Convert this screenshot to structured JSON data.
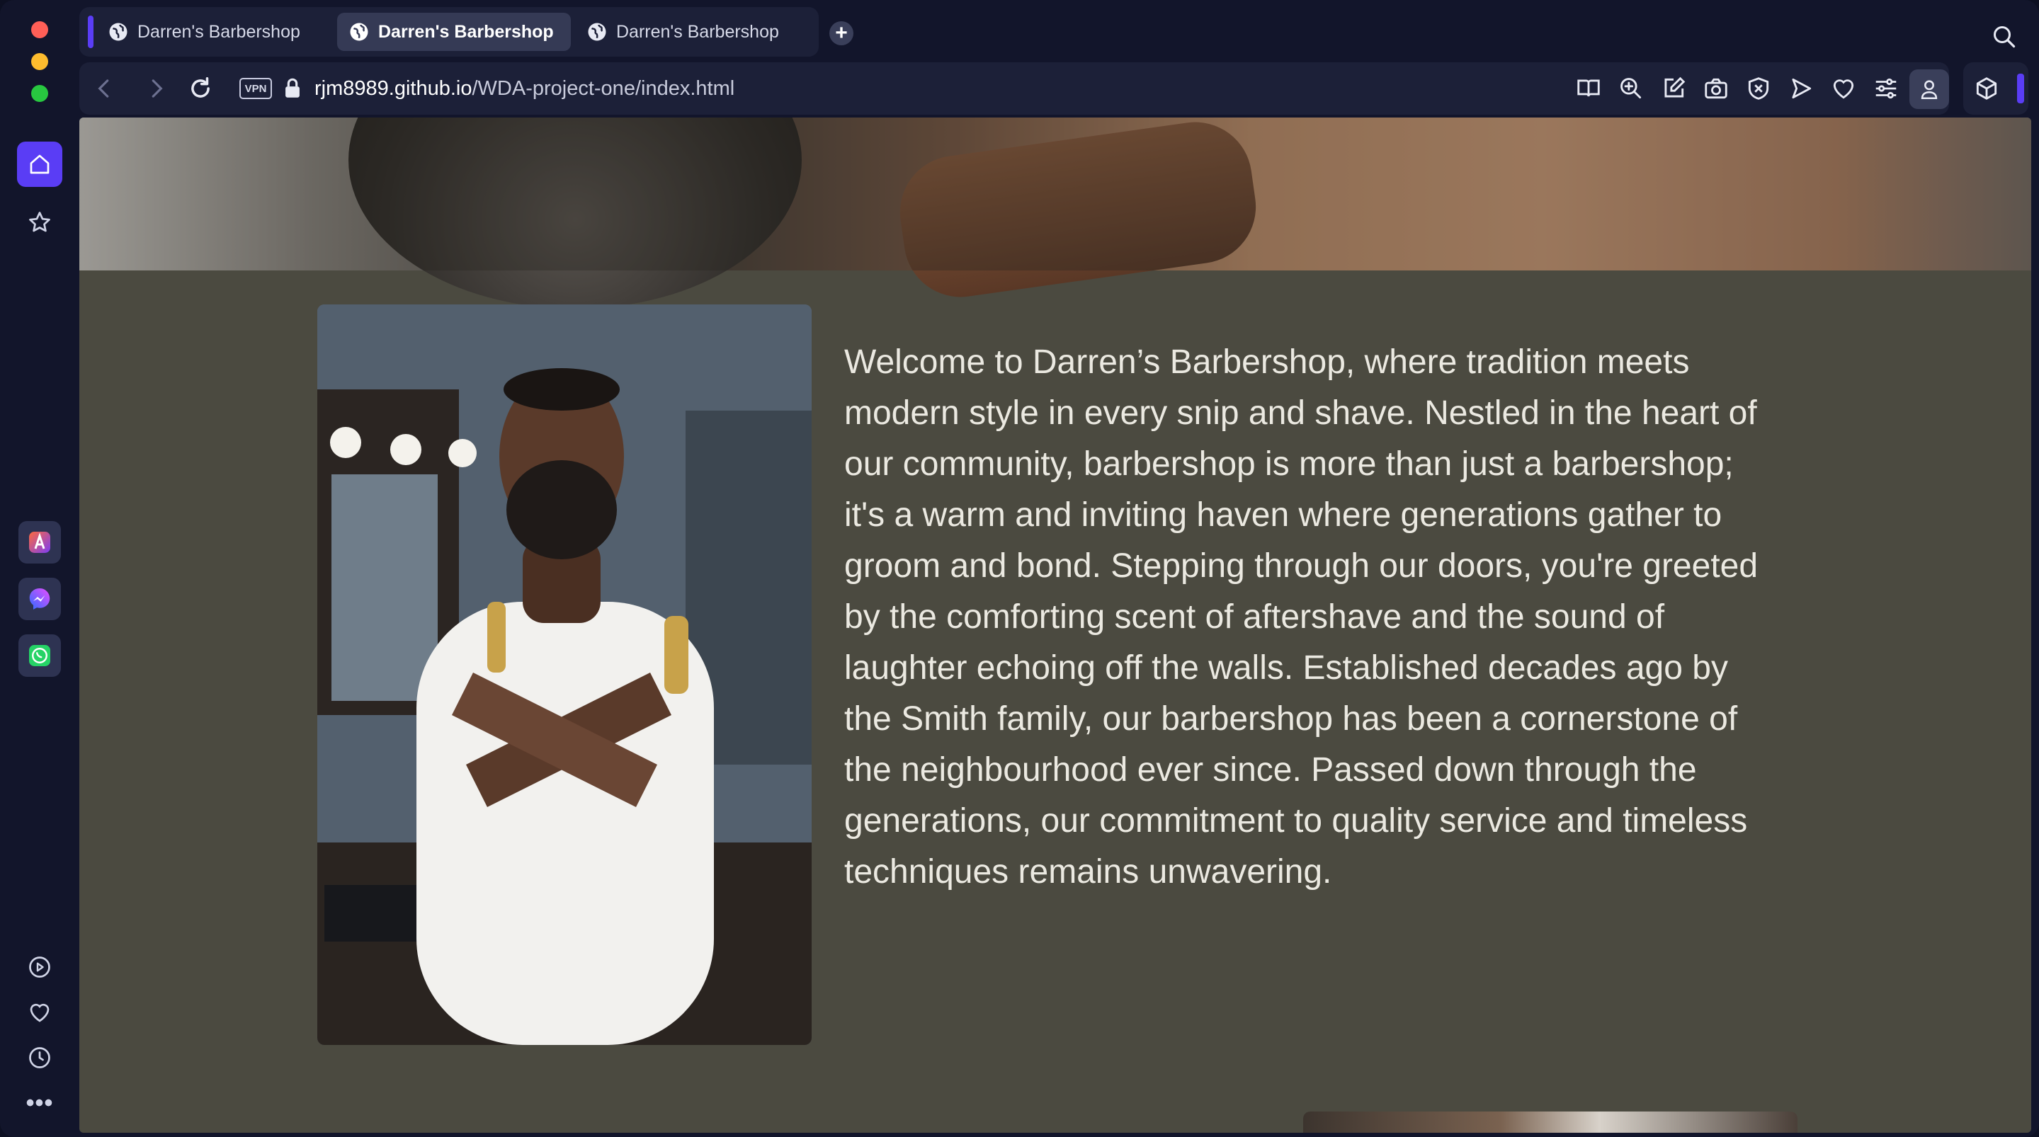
{
  "tabs": [
    {
      "title": "Darren's Barbershop",
      "active": false
    },
    {
      "title": "Darren's Barbershop",
      "active": true
    },
    {
      "title": "Darren's Barbershop",
      "active": false
    }
  ],
  "toolbar": {
    "new_tab_symbol": "+",
    "vpn_label": "VPN",
    "url_host": "rjm8989.github.io",
    "url_path": "/WDA-project-one/index.html"
  },
  "sidebar": {
    "items": [
      {
        "name": "home-icon",
        "active": true
      },
      {
        "name": "star-icon"
      },
      {
        "name": "aria-icon"
      },
      {
        "name": "messenger-icon"
      },
      {
        "name": "whatsapp-icon"
      },
      {
        "name": "player-icon"
      },
      {
        "name": "heart-icon"
      },
      {
        "name": "history-icon"
      }
    ],
    "more_label": "•••"
  },
  "page": {
    "welcome_text": "Welcome to Darren’s Barbershop, where tradition meets modern style in every snip and shave. Nestled in the heart of our community, barbershop is more than just a barbershop; it's a warm and inviting haven where generations gather to groom and bond. Stepping through our doors, you're greeted by the comforting scent of aftershave and the sound of laughter echoing off the walls. Established decades ago by the Smith family, our barbershop has been a cornerstone of the neighbourhood ever since. Passed down through the generations, our commitment to quality service and timeless techniques remains unwavering."
  },
  "colors": {
    "accent": "#5a3df5",
    "chrome_bg": "#12152b",
    "page_bg": "#4b4a40",
    "page_text": "#ebe9e1"
  }
}
